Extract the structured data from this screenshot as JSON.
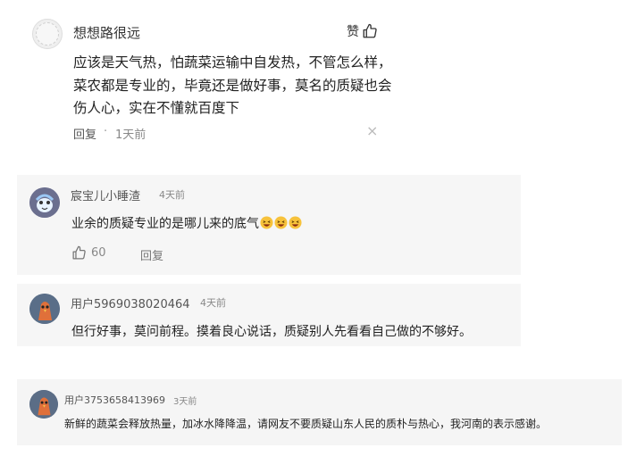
{
  "comment": {
    "username": "想想路很远",
    "like_label": "赞",
    "text": "应该是天气热，怕蔬菜运输中自发热，不管怎么样，菜农都是专业的，毕竟还是做好事，莫名的质疑也会伤人心，实在不懂就百度下",
    "reply_label": "回复",
    "separator": "·",
    "time": "1天前",
    "close_glyph": "×",
    "avatar_icon": "default-avatar-icon"
  },
  "replies": [
    {
      "username": "宸宝儿小睡渣",
      "time": "4天前",
      "text": "业余的质疑专业的是哪儿来的底气",
      "emoji_count": 3,
      "emoji_icon": "laughing-emoji-icon",
      "like_count": "60",
      "reply_label": "回复",
      "avatar_color": "#6b6f8f"
    },
    {
      "username": "用户5969038020464",
      "time": "4天前",
      "text": "但行好事，莫问前程。摸着良心说话，质疑别人先看看自己做的不够好。",
      "avatar_color": "#5a6e88"
    },
    {
      "username": "用户3753658413969",
      "time": "3天前",
      "text": "新鲜的蔬菜会释放热量，加冰水降降温，请网友不要质疑山东人民的质朴与热心，我河南的表示感谢。",
      "avatar_color": "#5b6d86"
    }
  ]
}
